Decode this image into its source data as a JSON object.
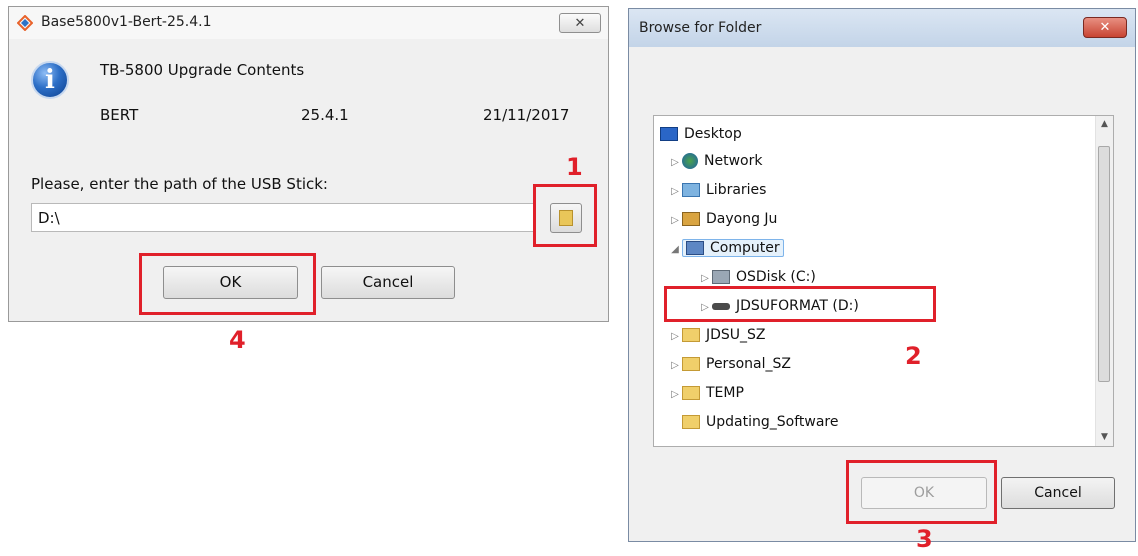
{
  "upgrade_dialog": {
    "title": "Base5800v1-Bert-25.4.1",
    "close_glyph": "✕",
    "heading": "TB-5800 Upgrade Contents",
    "module": "BERT",
    "version": "25.4.1",
    "date": "21/11/2017",
    "prompt": "Please, enter the path of the USB Stick:",
    "path_value": "D:\\",
    "ok_label": "OK",
    "cancel_label": "Cancel"
  },
  "folder_dialog": {
    "title": "Browse for Folder",
    "close_glyph": "✕",
    "tree": [
      {
        "label": "Desktop",
        "icon": "desktop-icon"
      },
      {
        "label": "Network",
        "icon": "network-icon"
      },
      {
        "label": "Libraries",
        "icon": "libraries-icon"
      },
      {
        "label": "Dayong Ju",
        "icon": "user-folder-icon"
      },
      {
        "label": "Computer",
        "icon": "computer-icon"
      },
      {
        "label": "OSDisk (C:)",
        "icon": "disk-icon"
      },
      {
        "label": "JDSUFORMAT (D:)",
        "icon": "usb-drive-icon"
      },
      {
        "label": "JDSU_SZ",
        "icon": "folder-icon"
      },
      {
        "label": "Personal_SZ",
        "icon": "folder-icon"
      },
      {
        "label": "TEMP",
        "icon": "folder-icon"
      },
      {
        "label": "Updating_Software",
        "icon": "folder-icon"
      }
    ],
    "ok_label": "OK",
    "cancel_label": "Cancel"
  },
  "annotations": {
    "step1": "1",
    "step2": "2",
    "step3": "3",
    "step4": "4"
  },
  "colors": {
    "annotation_red": "#e0202a"
  }
}
